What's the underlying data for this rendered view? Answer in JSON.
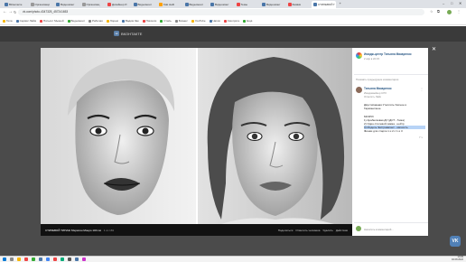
{
  "browser": {
    "tabs": [
      {
        "label": "ВКонтакте",
        "color": "#4a76a8"
      },
      {
        "label": "Организаци",
        "color": "#999999"
      },
      {
        "label": "Видеомонт",
        "color": "#4a76a8"
      },
      {
        "label": "Организац",
        "color": "#999999"
      },
      {
        "label": "Дизайнер И",
        "color": "#e44"
      },
      {
        "label": "Видеомонт",
        "color": "#4a76a8"
      },
      {
        "label": "Kak stelli",
        "color": "#ffa000"
      },
      {
        "label": "Видеомонт",
        "color": "#4a76a8"
      },
      {
        "label": "Видеомонт",
        "color": "#4a76a8"
      },
      {
        "label": "Темы",
        "color": "#e44"
      },
      {
        "label": "Видеомонт",
        "color": "#4a76a8"
      },
      {
        "label": "Заявки",
        "color": "#e44"
      },
      {
        "label": "СТИЛЕВОЙ Г",
        "color": "#4a76a8",
        "active": true
      }
    ],
    "new_tab": "+",
    "url": "vk.com/photo-4347325_457241653",
    "bookmarks": [
      "Гила",
      "Сервис Лайм",
      "Пятьсот Мышей",
      "Видеомонт",
      "Рабочая",
      "Лорем",
      "Вадим Зак",
      "Пиксели",
      "Стиль",
      "Бизнес",
      "YouTube",
      "Чатов",
      "Смотрите",
      "Ещё"
    ]
  },
  "vk": {
    "logo_text": "ВКОНТАКТЕ",
    "photo_caption": "СТИЛЕВОЙ ТИПАЖ Мэрилин Монро 100 см",
    "photo_counter": "1 из 181",
    "photo_actions": [
      "Поделиться",
      "Отметить человека",
      "Удалить",
      "Действия"
    ],
    "album_owner": "Имидж-центр Татьяна Макаренко",
    "album_date": "2 апр в 22:15",
    "comments_link": "Показать предыдущие комментарии",
    "comment": {
      "author": "Татьяна Макаренко",
      "meta1": "Имиджмейкер СПб",
      "meta2": "Ответить  Лайк",
      "body": [
        "Двухтипажная Утеплять Уютное и",
        "Гармоничное.",
        "",
        "МОЗГИ:",
        "1) Арабесковая ДУ (ДСТ - Тема)",
        "2) Один стилевой гамма - нейтр",
        "3) Модель Экстравагант - мягкость",
        "Фишки для старта 1 и 2 с 1 и 3"
      ],
      "time": "7 ч"
    },
    "comment_input_placeholder": "Написать комментарий...",
    "fab_label": "VK"
  },
  "taskbar": {
    "clock_time": "13:29",
    "clock_date": "02.08.2022"
  }
}
